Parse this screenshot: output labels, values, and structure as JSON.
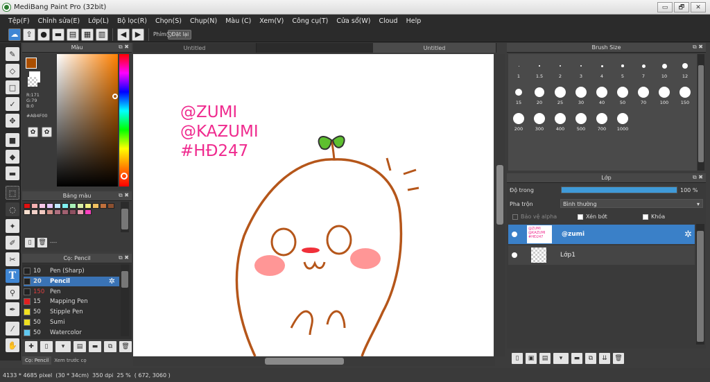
{
  "window": {
    "title": "MediBang Paint Pro (32bit)",
    "controls": [
      "▭",
      "🗗",
      "✕"
    ]
  },
  "menu": [
    "Tệp(F)",
    "Chỉnh sửa(E)",
    "Lớp(L)",
    "Bộ lọc(R)",
    "Chọn(S)",
    "Chụp(N)",
    "Màu (C)",
    "Xem(V)",
    "Công cụ(T)",
    "Cửa sổ(W)",
    "Cloud",
    "Help"
  ],
  "toolbar": {
    "keys_label": "Phím",
    "reset_label": "Đặt lại"
  },
  "color_panel": {
    "title": "Màu",
    "r": "R:171",
    "g": "G:79",
    "b": "B:0",
    "hex": "#AB4F00",
    "fg_color": "#AB4F00",
    "bg_color": "#ffffff"
  },
  "palette_panel": {
    "title": "Bảng màu",
    "status": "----",
    "colors": [
      "#e01010",
      "#f4b0b0",
      "#f8c8e8",
      "#e7c7ff",
      "#c0e8ff",
      "#7ff0f0",
      "#a8f0b8",
      "#d8f0a8",
      "#f0f080",
      "#f0c060",
      "#c0703c",
      "#8c5030",
      "#f8e0d0",
      "#f0d0c8",
      "#f0c8c0",
      "#d09088",
      "#b07080",
      "#a06070",
      "#8e5060",
      "#e8a0b0",
      "#ff40c0"
    ]
  },
  "brush_panel": {
    "title": "Cọ: Pencil",
    "items": [
      {
        "size": "10",
        "name": "Pen (Sharp)",
        "color": "#222222"
      },
      {
        "size": "20",
        "name": "Pencil",
        "color": "#222222"
      },
      {
        "size": "150",
        "name": "Pen",
        "color": "#222222"
      },
      {
        "size": "15",
        "name": "Mapping Pen",
        "color": "#e02020"
      },
      {
        "size": "50",
        "name": "Stipple Pen",
        "color": "#f0e020"
      },
      {
        "size": "50",
        "name": "Sumi",
        "color": "#f0e020"
      },
      {
        "size": "50",
        "name": "Watercolor",
        "color": "#60c8f0"
      }
    ],
    "tab_brush": "Cọ: Pencil",
    "tab_preview": "Xem trước cọ"
  },
  "doc_tabs": [
    "Untitled",
    "Untitled"
  ],
  "canvas_text": {
    "line1": "@ZUMI",
    "line2": "@KAZUMI",
    "line3": "#HĐ247"
  },
  "brush_size_panel": {
    "title": "Brush Size",
    "sizes": [
      "1",
      "1.5",
      "2",
      "3",
      "4",
      "5",
      "7",
      "10",
      "12",
      "15",
      "20",
      "25",
      "30",
      "40",
      "50",
      "70",
      "100",
      "150",
      "200",
      "300",
      "400",
      "500",
      "700",
      "1000"
    ]
  },
  "layer_panel": {
    "title": "Lớp",
    "opacity_label": "Độ trong",
    "opacity_value": "100 %",
    "blend_label": "Pha trộn",
    "blend_value": "Bình thường",
    "protect_alpha": "Bảo vệ alpha",
    "clipping": "Xén bớt",
    "lock": "Khóa",
    "layers": [
      {
        "name": "@zumi",
        "selected": true
      },
      {
        "name": "Lớp1",
        "selected": false
      }
    ]
  },
  "status": {
    "size": "4133 * 4685 pixel",
    "cm": "(30 * 34cm)",
    "dpi": "350 dpi",
    "zoom": "25 %",
    "coords": "( 672, 3060 )"
  }
}
